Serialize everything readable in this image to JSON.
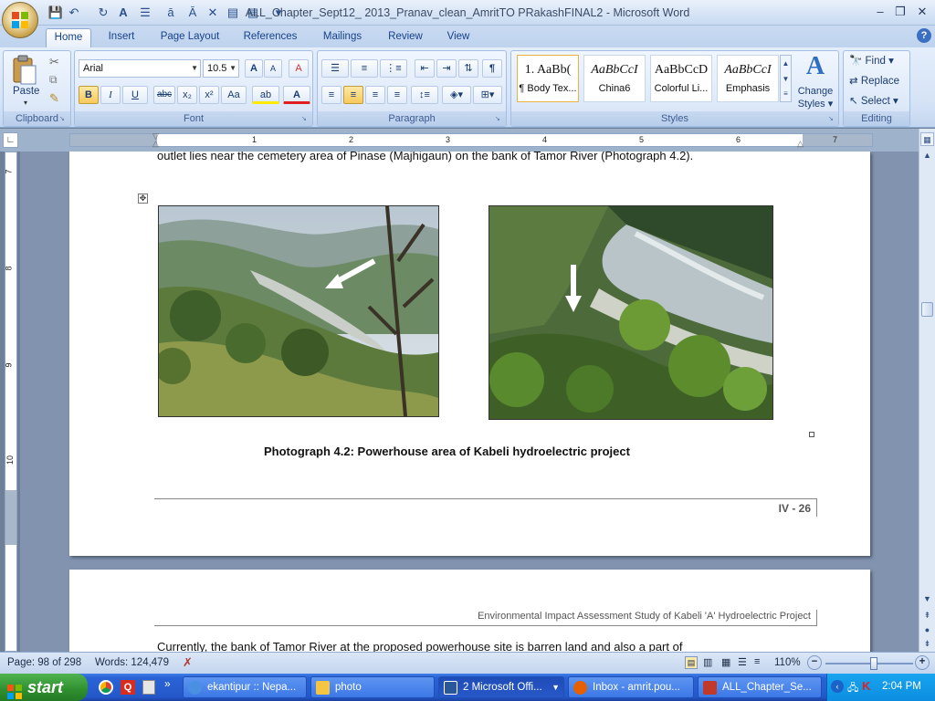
{
  "window": {
    "title": "ALL_Chapter_Sept12_ 2013_Pranav_clean_AmritTO PRakashFINAL2 - Microsoft Word",
    "minimize": "–",
    "restore": "❐",
    "close": "✕"
  },
  "qat": {
    "save": "💾",
    "undo": "↶",
    "redo": "↻",
    "more": "▾"
  },
  "tabs": [
    "Home",
    "Insert",
    "Page Layout",
    "References",
    "Mailings",
    "Review",
    "View"
  ],
  "help": "?",
  "ribbon": {
    "clipboard": {
      "label": "Clipboard",
      "paste": "Paste"
    },
    "font": {
      "label": "Font",
      "name": "Arial",
      "size": "10.5",
      "grow": "A",
      "shrink": "A",
      "clear": "A",
      "bold": "B",
      "italic": "I",
      "underline": "U",
      "strike": "abc",
      "sub": "x₂",
      "sup": "x²",
      "case": "Aa",
      "highlight": "ab",
      "color": "A"
    },
    "paragraph": {
      "label": "Paragraph",
      "pilcrow": "¶"
    },
    "styles": {
      "label": "Styles",
      "items": [
        {
          "sample": "1. AaBb(",
          "name": "¶ Body Tex..."
        },
        {
          "sample": "AaBbCcI",
          "name": "China6"
        },
        {
          "sample": "AaBbCcD",
          "name": "Colorful Li..."
        },
        {
          "sample": "AaBbCcI",
          "name": "Emphasis"
        }
      ],
      "change": "Change",
      "change2": "Styles ▾"
    },
    "editing": {
      "label": "Editing",
      "find": "Find ▾",
      "replace": "Replace",
      "select": "Select ▾"
    }
  },
  "ruler": {
    "numbers": [
      "1",
      "2",
      "3",
      "4",
      "5",
      "6",
      "7"
    ],
    "vnumbers": [
      "7",
      "8",
      "9",
      "10"
    ]
  },
  "document": {
    "top_line": "outlet lies near the cemetery area of Pinase (Majhigaun) on the bank of  Tamor River (Photograph 4.2).",
    "caption": "Photograph  4.2:  Powerhouse  area  of  Kabeli  hydroelectric  project",
    "page_number": "IV - 26",
    "header2": "Environmental Impact Assessment Study of Kabeli 'A' Hydroelectric Project",
    "body2": "Currently, the bank of Tamor River at the proposed powerhouse site is barren land and also a part of"
  },
  "status": {
    "page": "Page: 98 of 298",
    "words": "Words: 124,479",
    "zoom": "110%",
    "zoom_minus": "−",
    "zoom_plus": "+",
    "zoom_fraction": 0.55
  },
  "taskbar": {
    "start": "start",
    "items": [
      {
        "label": "ekantipur :: Nepa...",
        "color": "#4a90e2"
      },
      {
        "label": "photo",
        "color": "#f4c542"
      },
      {
        "label": "2 Microsoft Offi...",
        "color": "#2b579a"
      },
      {
        "label": "Inbox - amrit.pou...",
        "color": "#e66000"
      },
      {
        "label": "ALL_Chapter_Se...",
        "color": "#c0392b"
      }
    ],
    "time": "2:04 PM"
  }
}
